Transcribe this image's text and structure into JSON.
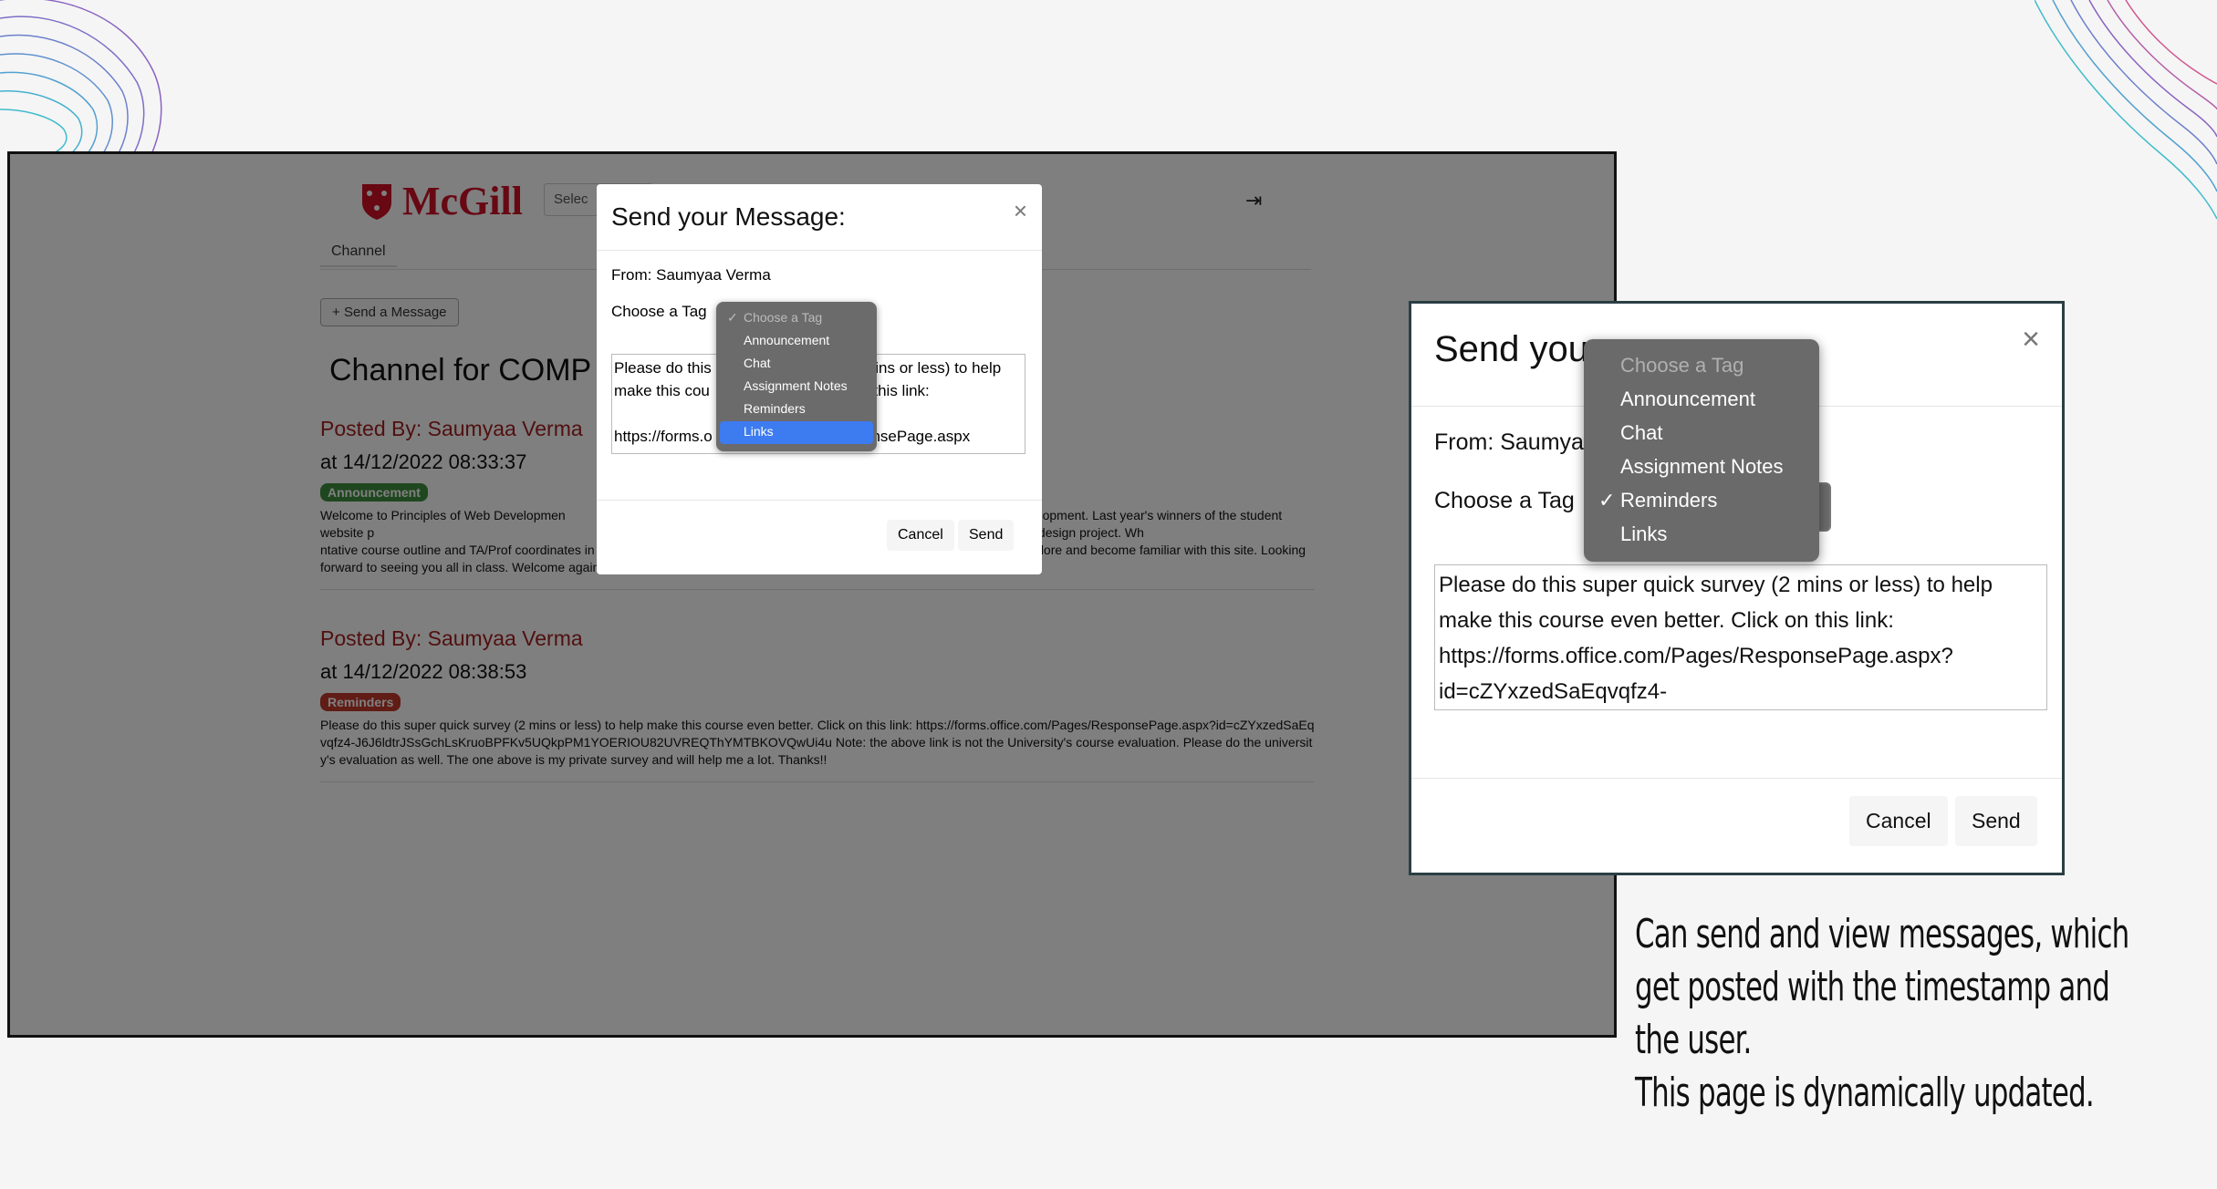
{
  "left_screenshot": {
    "logo_text": "McGill",
    "select_stub": "Selec",
    "tab_channel": "Channel",
    "send_message_button": "Send a Message",
    "channel_title": "Channel for COMP",
    "posts": [
      {
        "posted_by": "Posted By: Saumyaa Verma",
        "timestamp": "at 14/12/2022 08:33:37",
        "tag": "Announcement",
        "tag_color": "#3f8f3f",
        "body": "Welcome to Principles of Web Developmen                                                                                    end and backend website development. Last year's winners of the student website p                                                                                w.cs.mcgill.ca). I cannot wait to see which group will win this year's design project. Wh                                                                           ntative course outline and TA/Prof coordinates in the \"Couse Information\" tab under the menu item \"Content\" above. Please explore and become familiar with this site. Looking forward to seeing you all in class. Welcome again!"
      },
      {
        "posted_by": "Posted By: Saumyaa Verma",
        "timestamp": "at 14/12/2022 08:38:53",
        "tag": "Reminders",
        "tag_color": "#c0392b",
        "body": "Please do this super quick survey (2 mins or less) to help make this course even better. Click on this link: https://forms.office.com/Pages/ResponsePage.aspx?id=cZYxzedSaEqvqfz4-J6J6ldtrJSsGchLsKruoBPFKv5UQkpPM1YOERIOU82UVREQThYMTBKOVQwUi4u Note: the above link is not the University's course evaluation. Please do the university's evaluation as well. The one above is my private survey and will help me a lot. Thanks!!"
      }
    ],
    "modal": {
      "title": "Send your Message:",
      "from": "From: Saumyaa Verma",
      "choose_tag": "Choose a Tag",
      "textarea": "Please do this                                   mins or less) to help\nmake this cou                                   n this link:\n\nhttps://forms.o                                   onsePage.aspx",
      "cancel": "Cancel",
      "send": "Send",
      "dropdown_options": [
        "Choose a Tag",
        "Announcement",
        "Chat",
        "Assignment Notes",
        "Reminders",
        "Links"
      ],
      "dropdown_checked": "Choose a Tag",
      "dropdown_highlight": "Links"
    }
  },
  "zoomed_modal": {
    "title": "Send you",
    "from": "From: Saumya",
    "choose_tag": "Choose a Tag",
    "textarea": "Please do this super quick survey (2 mins or less) to help make this course even better. Click on this link: https://forms.office.com/Pages/ResponsePage.aspx?id=cZYxzedSaEqvqfz4-",
    "cancel": "Cancel",
    "send": "Send",
    "dropdown_options": [
      "Choose a Tag",
      "Announcement",
      "Chat",
      "Assignment Notes",
      "Reminders",
      "Links"
    ],
    "dropdown_checked": "Reminders"
  },
  "caption": {
    "line1": "Can send and view messages, which",
    "line2": "get posted with the timestamp and",
    "line3": "the user.",
    "line4": "This page is dynamically updated."
  },
  "colors": {
    "accent_red": "#ce1126",
    "post_author": "#a32020",
    "select_highlight": "#3d7bf0",
    "zoom_border": "#2a3f44"
  }
}
